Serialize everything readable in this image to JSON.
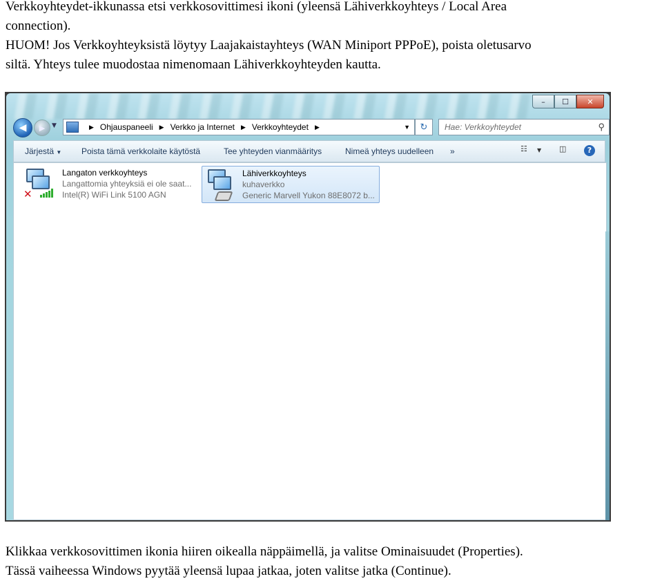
{
  "text_top": [
    "Verkkoyhteydet-ikkunassa etsi verkkosovittimesi ikoni (yleensä Lähiverkkoyhteys / Local Area",
    "connection)."
  ],
  "text_note": [
    "HUOM! Jos Verkkoyhteyksistä löytyy Laajakaistayhteys (WAN Miniport PPPoE), poista oletusarvo",
    "siltä. Yhteys tulee muodostaa nimenomaan Lähiverkkoyhteyden kautta."
  ],
  "text_bottom": [
    "Klikkaa verkkosovittimen ikonia hiiren oikealla näppäimellä, ja valitse Ominaisuudet (Properties).",
    "Tässä vaiheessa Windows pyytää yleensä lupaa jatkaa, joten valitse jatka (Continue)."
  ],
  "window": {
    "caption_buttons": {
      "minimize": "–",
      "maximize": "☐",
      "close": "✕"
    },
    "nav": {
      "back_icon": "back-arrow-icon",
      "forward_icon": "forward-arrow-icon",
      "breadcrumbs": [
        "Ohjauspaneeli",
        "Verkko ja Internet",
        "Verkkoyhteydet"
      ],
      "search_placeholder": "Hae: Verkkoyhteydet"
    },
    "toolbar": {
      "organize": "Järjestä",
      "disable": "Poista tämä verkkolaite käytöstä",
      "diagnose": "Tee yhteyden vianmääritys",
      "rename": "Nimeä yhteys uudelleen",
      "more": "»",
      "help": "?"
    },
    "connections": [
      {
        "name": "Langaton verkkoyhteys",
        "status": "Langattomia yhteyksiä ei ole saat...",
        "device": "Intel(R) WiFi Link 5100 AGN",
        "icon": "wireless-network-icon",
        "selected": false
      },
      {
        "name": "Lähiverkkoyhteys",
        "status": "kuhaverkko",
        "device": "Generic Marvell Yukon 88E8072 b...",
        "icon": "wired-network-icon",
        "selected": true
      }
    ]
  }
}
